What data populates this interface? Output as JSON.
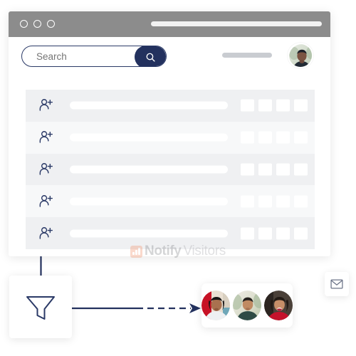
{
  "browser": {
    "window_controls": [
      {
        "name": "close-dot"
      },
      {
        "name": "minimize-dot"
      },
      {
        "name": "maximize-dot"
      }
    ],
    "url_bar_value": "",
    "toolbar": {
      "search_placeholder": "Search",
      "search_value": "",
      "search_button_icon": "search-icon",
      "header_pill_value": "",
      "user_avatar_alt": ""
    },
    "list": {
      "row_icon": "person-add-icon",
      "rows": [
        {
          "label": "",
          "squares": [
            "",
            "",
            "",
            ""
          ]
        },
        {
          "label": "",
          "squares": [
            "",
            "",
            "",
            ""
          ]
        },
        {
          "label": "",
          "squares": [
            "",
            "",
            "",
            ""
          ]
        },
        {
          "label": "",
          "squares": [
            "",
            "",
            "",
            ""
          ]
        },
        {
          "label": "",
          "squares": [
            "",
            "",
            "",
            ""
          ]
        }
      ]
    }
  },
  "watermark": {
    "logo_icon": "bar-chart-logo-icon",
    "brand_bold": "Notify",
    "brand_light": "Visitors",
    "brand_color": "#f0845a"
  },
  "funnel": {
    "icon": "funnel-icon",
    "label": ""
  },
  "audience": {
    "avatars": [
      {
        "name": "avatar-person-1",
        "alt": ""
      },
      {
        "name": "avatar-person-2",
        "alt": ""
      },
      {
        "name": "avatar-person-3",
        "alt": ""
      }
    ]
  },
  "mail": {
    "icon": "envelope-icon",
    "label": ""
  },
  "colors": {
    "navy": "#23315e",
    "titlebar_gray": "#8c8c8c",
    "row_dark": "#eff0f2",
    "row_light": "#f7f8f9",
    "placeholder_gray": "#a9acb3",
    "pill_gray": "#c9ccd1"
  }
}
